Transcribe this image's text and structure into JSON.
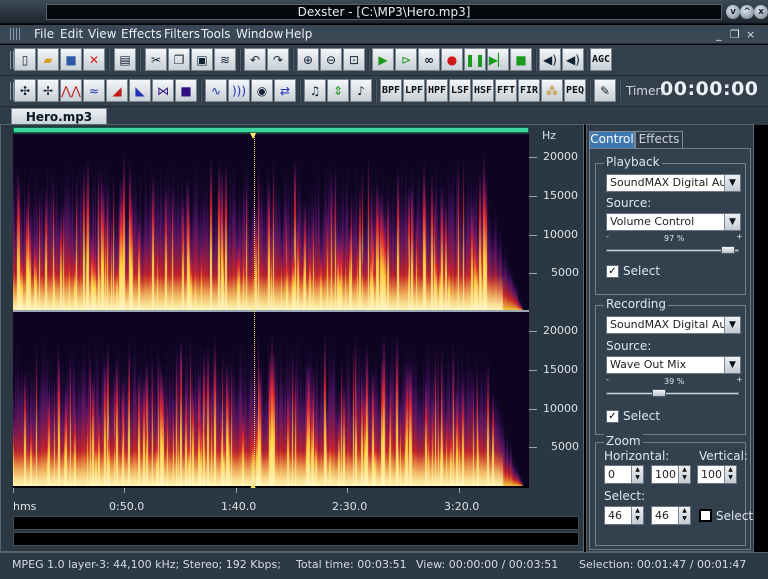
{
  "window": {
    "title": "Dexster - [C:\\MP3\\Hero.mp3]",
    "controls": [
      "v",
      "^",
      "x"
    ]
  },
  "menu": [
    "File",
    "Edit",
    "View",
    "Effects",
    "Filters",
    "Tools",
    "Window",
    "Help"
  ],
  "mdi_controls": [
    "_",
    "❐",
    "×"
  ],
  "toolbar1": [
    "new-file",
    "open-folder",
    "save",
    "close",
    "properties",
    "cut",
    "copy",
    "paste",
    "mix-paste",
    "undo",
    "redo",
    "zoom-in",
    "zoom-out",
    "zoom-fit",
    "play",
    "play-selection",
    "loop",
    "record",
    "pause",
    "play-from",
    "stop",
    "volume-left",
    "volume-right",
    "agc"
  ],
  "toolbar1_agc": "AGC",
  "toolbar2_filters": [
    "BPF",
    "LPF",
    "HPF",
    "LSF",
    "HSF",
    "FFT",
    "FIR",
    "PEQ"
  ],
  "timer": {
    "label": "Timer:",
    "value": "00:00:00"
  },
  "document": {
    "tab": "Hero.mp3"
  },
  "spectrogram": {
    "freq_unit": "Hz",
    "freq_ticks": [
      "20000",
      "15000",
      "10000",
      "5000"
    ],
    "time_start_label": "hms",
    "time_ticks": [
      "0:50.0",
      "1:40.0",
      "2:30.0",
      "3:20.0"
    ],
    "cursor_fraction": 0.467,
    "colors": {
      "bg": "#0d0520",
      "low": "#7a1aa0",
      "mid": "#e0242c",
      "high": "#ffd23c",
      "peak": "#fff7c8",
      "progress": "#3dd6a0"
    }
  },
  "panel": {
    "tabs": [
      "Control",
      "Effects"
    ],
    "playback": {
      "title": "Playback",
      "device": "SoundMAX Digital Audio",
      "source_label": "Source:",
      "source": "Volume Control",
      "minus": "-",
      "plus": "+",
      "volume_pct": "97 %",
      "volume_value": 97,
      "select_label": "Select"
    },
    "recording": {
      "title": "Recording",
      "device": "SoundMAX Digital Audio",
      "source_label": "Source:",
      "source": "Wave Out Mix",
      "minus": "-",
      "plus": "+",
      "volume_pct": "39 %",
      "volume_value": 39,
      "select_label": "Select"
    },
    "zoom": {
      "title": "Zoom",
      "horizontal_label": "Horizontal:",
      "vertical_label": "Vertical:",
      "h_min": "0",
      "h_max": "100",
      "vertical": "100",
      "select_label": "Select:",
      "sel_a": "46",
      "sel_b": "46",
      "select_check_label": "Select"
    }
  },
  "status": {
    "format": "MPEG 1.0 layer-3: 44,100 kHz; Stereo; 192 Kbps;",
    "total": "Total time: 00:03:51",
    "view": "View: 00:00:00 / 00:03:51",
    "selection": "Selection: 00:01:47 / 00:01:47"
  }
}
